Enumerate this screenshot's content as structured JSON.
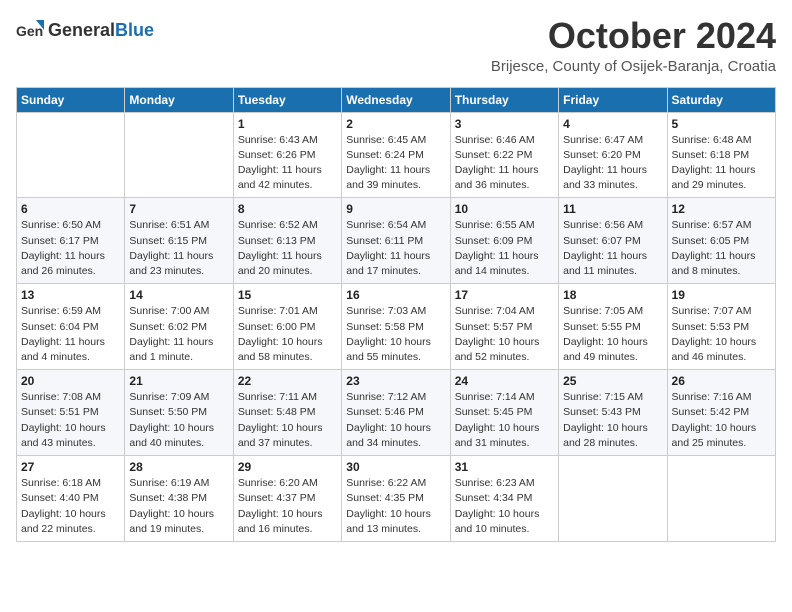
{
  "header": {
    "logo_general": "General",
    "logo_blue": "Blue",
    "month_title": "October 2024",
    "location": "Brijesce, County of Osijek-Baranja, Croatia"
  },
  "days_of_week": [
    "Sunday",
    "Monday",
    "Tuesday",
    "Wednesday",
    "Thursday",
    "Friday",
    "Saturday"
  ],
  "weeks": [
    [
      {
        "day": "",
        "detail": ""
      },
      {
        "day": "",
        "detail": ""
      },
      {
        "day": "1",
        "detail": "Sunrise: 6:43 AM\nSunset: 6:26 PM\nDaylight: 11 hours and 42 minutes."
      },
      {
        "day": "2",
        "detail": "Sunrise: 6:45 AM\nSunset: 6:24 PM\nDaylight: 11 hours and 39 minutes."
      },
      {
        "day": "3",
        "detail": "Sunrise: 6:46 AM\nSunset: 6:22 PM\nDaylight: 11 hours and 36 minutes."
      },
      {
        "day": "4",
        "detail": "Sunrise: 6:47 AM\nSunset: 6:20 PM\nDaylight: 11 hours and 33 minutes."
      },
      {
        "day": "5",
        "detail": "Sunrise: 6:48 AM\nSunset: 6:18 PM\nDaylight: 11 hours and 29 minutes."
      }
    ],
    [
      {
        "day": "6",
        "detail": "Sunrise: 6:50 AM\nSunset: 6:17 PM\nDaylight: 11 hours and 26 minutes."
      },
      {
        "day": "7",
        "detail": "Sunrise: 6:51 AM\nSunset: 6:15 PM\nDaylight: 11 hours and 23 minutes."
      },
      {
        "day": "8",
        "detail": "Sunrise: 6:52 AM\nSunset: 6:13 PM\nDaylight: 11 hours and 20 minutes."
      },
      {
        "day": "9",
        "detail": "Sunrise: 6:54 AM\nSunset: 6:11 PM\nDaylight: 11 hours and 17 minutes."
      },
      {
        "day": "10",
        "detail": "Sunrise: 6:55 AM\nSunset: 6:09 PM\nDaylight: 11 hours and 14 minutes."
      },
      {
        "day": "11",
        "detail": "Sunrise: 6:56 AM\nSunset: 6:07 PM\nDaylight: 11 hours and 11 minutes."
      },
      {
        "day": "12",
        "detail": "Sunrise: 6:57 AM\nSunset: 6:05 PM\nDaylight: 11 hours and 8 minutes."
      }
    ],
    [
      {
        "day": "13",
        "detail": "Sunrise: 6:59 AM\nSunset: 6:04 PM\nDaylight: 11 hours and 4 minutes."
      },
      {
        "day": "14",
        "detail": "Sunrise: 7:00 AM\nSunset: 6:02 PM\nDaylight: 11 hours and 1 minute."
      },
      {
        "day": "15",
        "detail": "Sunrise: 7:01 AM\nSunset: 6:00 PM\nDaylight: 10 hours and 58 minutes."
      },
      {
        "day": "16",
        "detail": "Sunrise: 7:03 AM\nSunset: 5:58 PM\nDaylight: 10 hours and 55 minutes."
      },
      {
        "day": "17",
        "detail": "Sunrise: 7:04 AM\nSunset: 5:57 PM\nDaylight: 10 hours and 52 minutes."
      },
      {
        "day": "18",
        "detail": "Sunrise: 7:05 AM\nSunset: 5:55 PM\nDaylight: 10 hours and 49 minutes."
      },
      {
        "day": "19",
        "detail": "Sunrise: 7:07 AM\nSunset: 5:53 PM\nDaylight: 10 hours and 46 minutes."
      }
    ],
    [
      {
        "day": "20",
        "detail": "Sunrise: 7:08 AM\nSunset: 5:51 PM\nDaylight: 10 hours and 43 minutes."
      },
      {
        "day": "21",
        "detail": "Sunrise: 7:09 AM\nSunset: 5:50 PM\nDaylight: 10 hours and 40 minutes."
      },
      {
        "day": "22",
        "detail": "Sunrise: 7:11 AM\nSunset: 5:48 PM\nDaylight: 10 hours and 37 minutes."
      },
      {
        "day": "23",
        "detail": "Sunrise: 7:12 AM\nSunset: 5:46 PM\nDaylight: 10 hours and 34 minutes."
      },
      {
        "day": "24",
        "detail": "Sunrise: 7:14 AM\nSunset: 5:45 PM\nDaylight: 10 hours and 31 minutes."
      },
      {
        "day": "25",
        "detail": "Sunrise: 7:15 AM\nSunset: 5:43 PM\nDaylight: 10 hours and 28 minutes."
      },
      {
        "day": "26",
        "detail": "Sunrise: 7:16 AM\nSunset: 5:42 PM\nDaylight: 10 hours and 25 minutes."
      }
    ],
    [
      {
        "day": "27",
        "detail": "Sunrise: 6:18 AM\nSunset: 4:40 PM\nDaylight: 10 hours and 22 minutes."
      },
      {
        "day": "28",
        "detail": "Sunrise: 6:19 AM\nSunset: 4:38 PM\nDaylight: 10 hours and 19 minutes."
      },
      {
        "day": "29",
        "detail": "Sunrise: 6:20 AM\nSunset: 4:37 PM\nDaylight: 10 hours and 16 minutes."
      },
      {
        "day": "30",
        "detail": "Sunrise: 6:22 AM\nSunset: 4:35 PM\nDaylight: 10 hours and 13 minutes."
      },
      {
        "day": "31",
        "detail": "Sunrise: 6:23 AM\nSunset: 4:34 PM\nDaylight: 10 hours and 10 minutes."
      },
      {
        "day": "",
        "detail": ""
      },
      {
        "day": "",
        "detail": ""
      }
    ]
  ]
}
